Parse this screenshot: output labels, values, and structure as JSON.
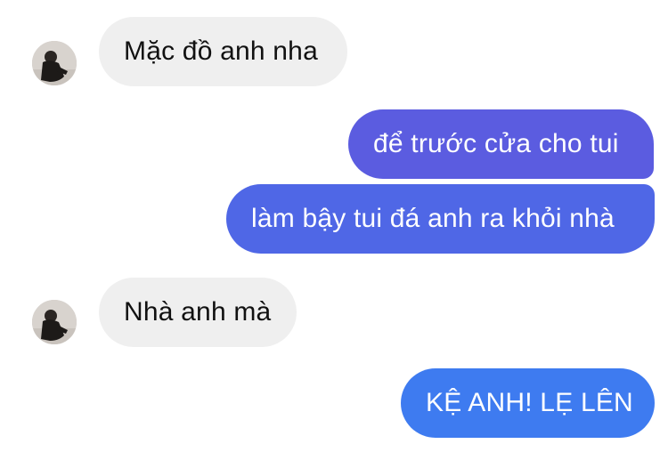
{
  "conversation": {
    "messages": [
      {
        "sender": "contact",
        "text": "Mặc đồ anh nha"
      },
      {
        "sender": "me",
        "text": "để trước cửa cho tui"
      },
      {
        "sender": "me",
        "text": "làm bậy tui đá anh ra khỏi nhà"
      },
      {
        "sender": "contact",
        "text": "Nhà anh mà"
      },
      {
        "sender": "me",
        "text": "KỆ ANH! LẸ LÊN"
      }
    ]
  },
  "colors": {
    "incoming_bubble": "#efefef",
    "outgoing_bubble_top": "#5b5ce0",
    "outgoing_bubble_mid": "#4f67e6",
    "outgoing_bubble_bottom": "#3e7bf0",
    "incoming_text": "#111111",
    "outgoing_text": "#ffffff"
  }
}
